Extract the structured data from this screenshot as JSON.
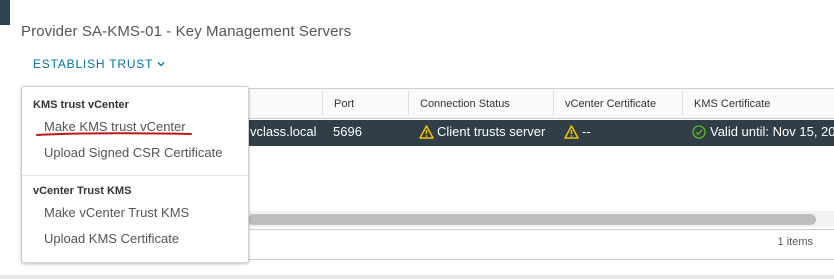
{
  "page": {
    "title": "Provider SA-KMS-01 - Key Management Servers"
  },
  "toolbar": {
    "establish_trust_label": "ESTABLISH TRUST"
  },
  "grid": {
    "columns": [
      "Port",
      "Connection Status",
      "vCenter Certificate",
      "KMS Certificate"
    ],
    "row": {
      "address_partial": "vclass.local",
      "port": "5696",
      "connection_status": "Client trusts server",
      "vcenter_certificate": "--",
      "kms_certificate": "Valid until: Nov 15, 20"
    },
    "item_count": "1 items"
  },
  "menu": {
    "section1_header": "KMS trust vCenter",
    "section1_items": [
      "Make KMS trust vCenter",
      "Upload Signed CSR Certificate"
    ],
    "section2_header": "vCenter Trust KMS",
    "section2_items": [
      "Make vCenter Trust KMS",
      "Upload KMS Certificate"
    ]
  },
  "colors": {
    "accent": "#0072a3",
    "selected_row": "#2f3e47",
    "warning": "#f5c200",
    "success": "#5eb715",
    "annotation": "#c0161d"
  }
}
